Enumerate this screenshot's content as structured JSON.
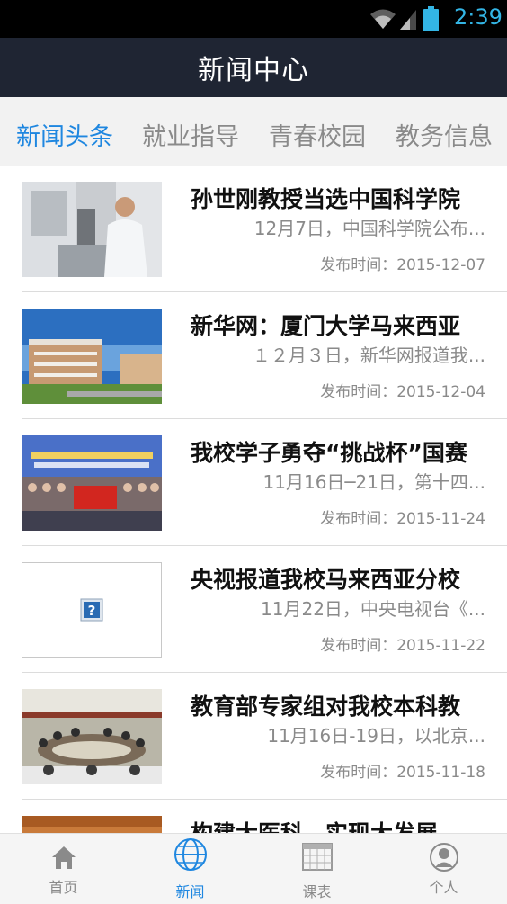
{
  "status_bar": {
    "time": "2:39",
    "icons": [
      "wifi-icon",
      "signal-icon",
      "battery-icon"
    ],
    "color": "#33b5e5"
  },
  "header": {
    "title": "新闻中心",
    "background": "#1f2533"
  },
  "tabs": [
    {
      "label": "新闻头条",
      "active": true
    },
    {
      "label": "就业指导",
      "active": false
    },
    {
      "label": "青春校园",
      "active": false
    },
    {
      "label": "教务信息",
      "active": false
    }
  ],
  "news": [
    {
      "headline": "孙世刚教授当选中国科学院",
      "summary": "12月7日，中国科学院公布...",
      "date": "发布时间：2015-12-07",
      "thumbnail": "lab-photo"
    },
    {
      "headline": "新华网：厦门大学马来西亚",
      "summary": "１２月３日，新华网报道我...",
      "date": "发布时间：2015-12-04",
      "thumbnail": "campus-building-photo"
    },
    {
      "headline": "我校学子勇夺“挑战杯”国赛",
      "summary": "11月16日─21日，第十四...",
      "date": "发布时间：2015-11-24",
      "thumbnail": "group-photo-banner"
    },
    {
      "headline": "央视报道我校马来西亚分校",
      "summary": "11月22日，中央电视台《...",
      "date": "发布时间：2015-11-22",
      "thumbnail": "missing-image-placeholder"
    },
    {
      "headline": "教育部专家组对我校本科教",
      "summary": "11月16日-19日，以北京...",
      "date": "发布时间：2015-11-18",
      "thumbnail": "meeting-room-photo"
    },
    {
      "headline": "构建大医科，实现大发展",
      "summary": "",
      "date": "",
      "thumbnail": "meeting-photo"
    }
  ],
  "bottom_nav": [
    {
      "label": "首页",
      "icon": "home-icon",
      "active": false
    },
    {
      "label": "新闻",
      "icon": "globe-icon",
      "active": true
    },
    {
      "label": "课表",
      "icon": "calendar-icon",
      "active": false
    },
    {
      "label": "个人",
      "icon": "person-icon",
      "active": false
    }
  ],
  "colors": {
    "accent": "#1f87e0",
    "muted_text": "#8a8a8a",
    "tab_bar_bg": "#f2f2f2"
  }
}
